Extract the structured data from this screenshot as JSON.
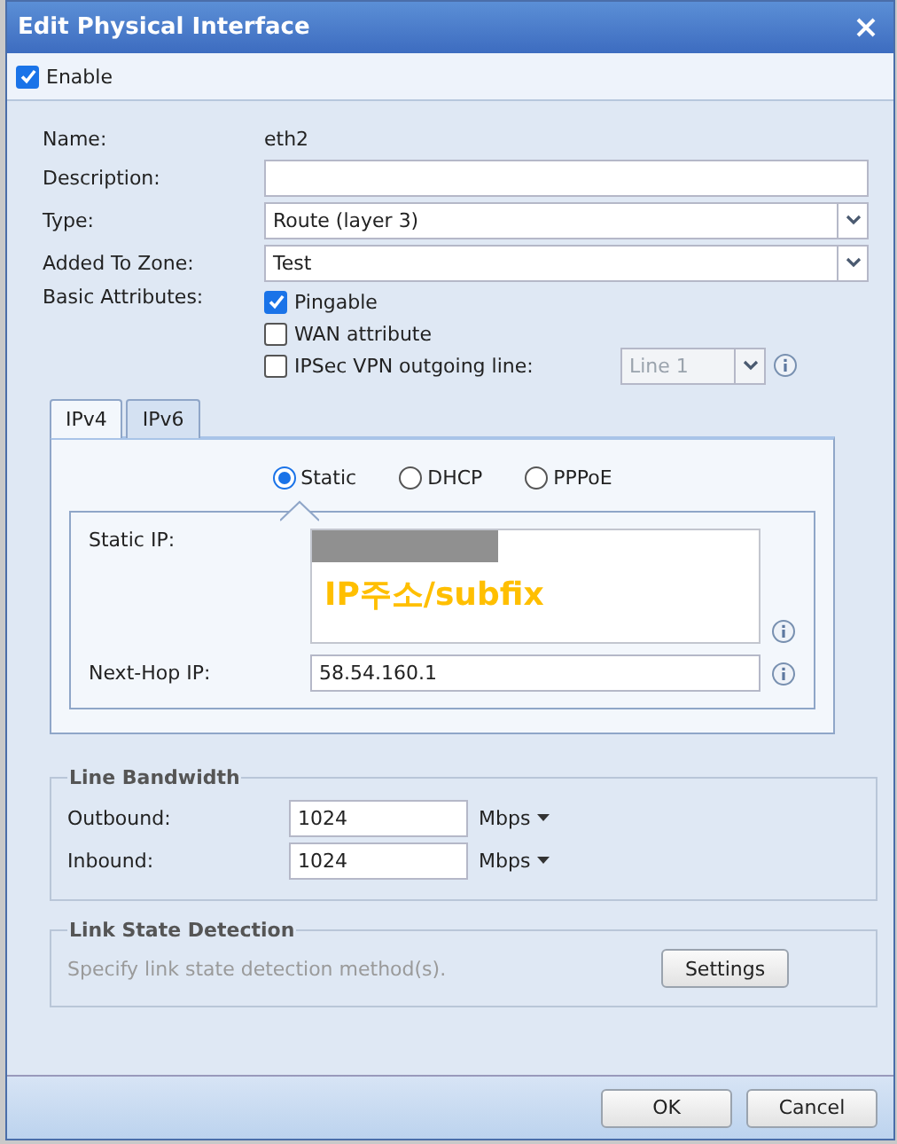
{
  "window": {
    "title": "Edit Physical Interface"
  },
  "enable": {
    "label": "Enable",
    "checked": true
  },
  "form": {
    "name": {
      "label": "Name:",
      "value": "eth2"
    },
    "description": {
      "label": "Description:"
    },
    "type": {
      "label": "Type:",
      "value": "Route (layer 3)"
    },
    "zone": {
      "label": "Added To Zone:",
      "value": "Test"
    },
    "basic_attributes": {
      "label": "Basic Attributes:",
      "options": [
        {
          "kind": "plain",
          "label": "Pingable",
          "checked": true
        },
        {
          "kind": "plain",
          "label": "WAN attribute",
          "checked": false
        },
        {
          "kind": "select",
          "label": "IPSec VPN outgoing line:",
          "checked": false,
          "select": {
            "value": "Line 1",
            "disabled": true
          }
        }
      ]
    }
  },
  "tabs": [
    {
      "label": "IPv4",
      "selected": true
    },
    {
      "label": "IPv6",
      "selected": false
    }
  ],
  "ipv4": {
    "modes": [
      {
        "label": "Static",
        "selected": true
      },
      {
        "label": "DHCP",
        "selected": false
      },
      {
        "label": "PPPoE",
        "selected": false
      }
    ],
    "static_ip": {
      "label": "Static IP:",
      "annotation": "IP주소/subfix"
    },
    "next_hop": {
      "label": "Next-Hop IP:",
      "value": "58.54.160.1"
    }
  },
  "bandwidth": {
    "title": "Line Bandwidth",
    "rows": [
      {
        "label": "Outbound:",
        "value": "1024",
        "unit": "Mbps"
      },
      {
        "label": "Inbound:",
        "value": "1024",
        "unit": "Mbps"
      }
    ]
  },
  "link_state": {
    "title": "Link State Detection",
    "hint": "Specify link state detection method(s).",
    "button": "Settings"
  },
  "buttons": [
    "OK",
    "Cancel"
  ]
}
